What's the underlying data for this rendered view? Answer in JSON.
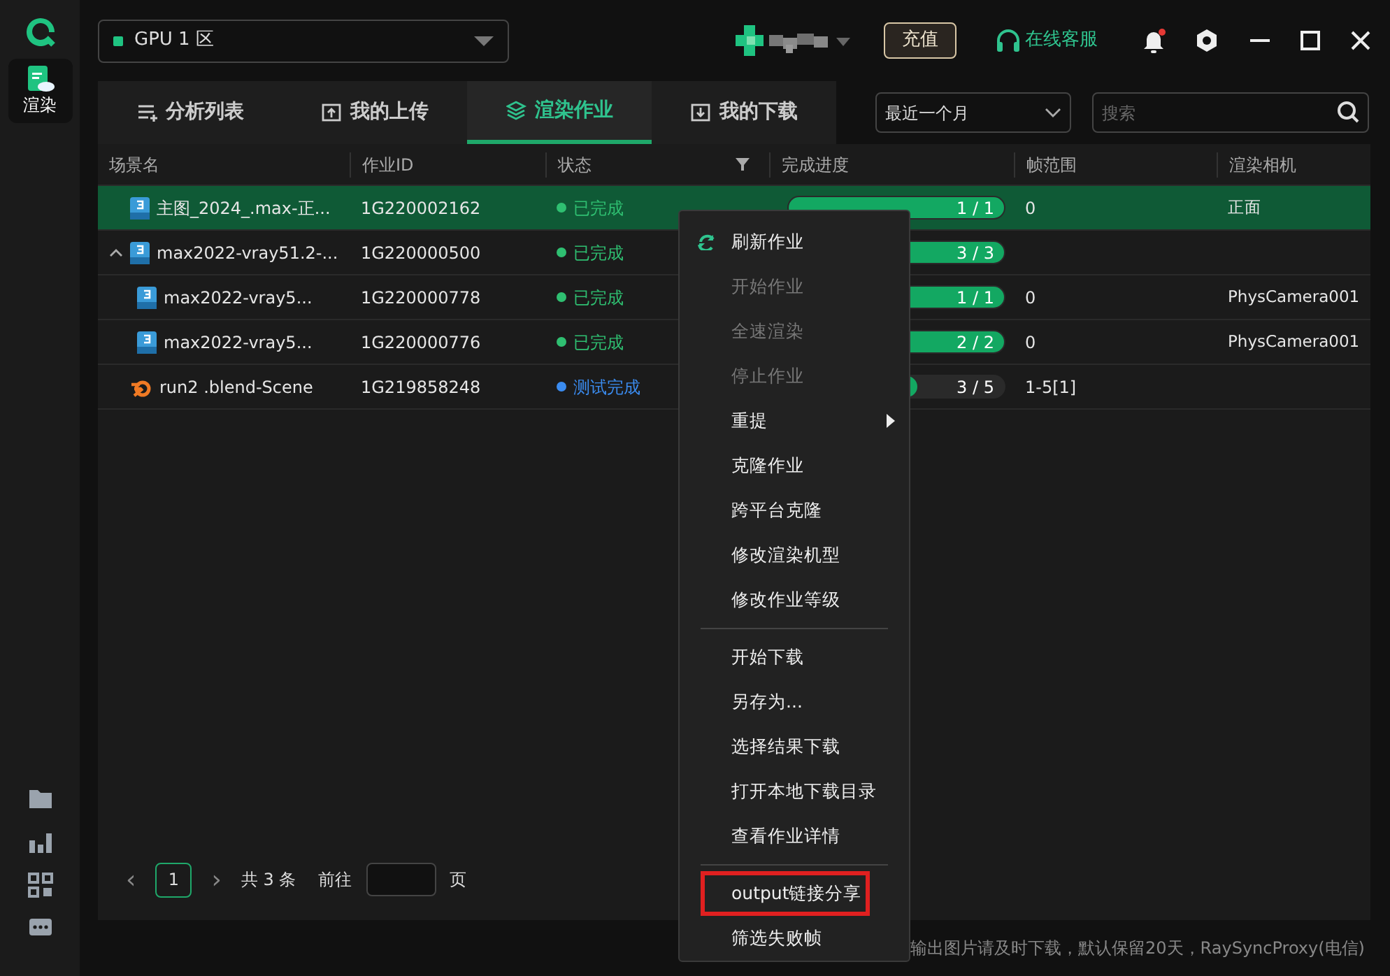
{
  "sidebar": {
    "items": [
      {
        "label": "渲染",
        "selected": true
      }
    ]
  },
  "region": {
    "label": "GPU 1 区"
  },
  "header": {
    "recharge": "充值",
    "support": "在线客服",
    "notification": true
  },
  "tabs": [
    {
      "label": "分析列表",
      "selected": false
    },
    {
      "label": "我的上传",
      "selected": false
    },
    {
      "label": "渲染作业",
      "selected": true
    },
    {
      "label": "我的下载",
      "selected": false
    }
  ],
  "period": {
    "value": "最近一个月"
  },
  "search": {
    "placeholder": "搜索"
  },
  "table": {
    "columns": [
      "场景名",
      "作业ID",
      "状态",
      "完成进度",
      "帧范围",
      "渲染相机"
    ],
    "rows": [
      {
        "kind": "max",
        "name": "主图_2024_.max-正...",
        "id": "1G220002162",
        "status": "已完成",
        "color": "#2fbf71",
        "level": 1,
        "count": "1 / 1",
        "frames": "0",
        "camera": "正面",
        "selected": true
      },
      {
        "kind": "max",
        "name": "max2022-vray51.2-...",
        "id": "1G220000500",
        "status": "已完成",
        "color": "#2fbf71",
        "level": 1,
        "count": "3 / 3",
        "selected": false,
        "expanded": true,
        "children": [
          {
            "kind": "max",
            "name": "max2022-vray5...",
            "id": "1G220000778",
            "status": "已完成",
            "color": "#2fbf71",
            "level": 1,
            "count": "1 / 1",
            "frames": "0",
            "camera": "PhysCamera001",
            "selected": false
          },
          {
            "kind": "max",
            "name": "max2022-vray5...",
            "id": "1G220000776",
            "status": "已完成",
            "color": "#2fbf71",
            "level": 1,
            "count": "2 / 2",
            "frames": "0",
            "camera": "PhysCamera001",
            "selected": false
          }
        ]
      },
      {
        "kind": "blend",
        "name": "run2 .blend-Scene",
        "id": "1G219858248",
        "status": "测试完成",
        "color": "#3b8cf0",
        "level": 0.6,
        "count": "3 / 5",
        "frames": "1-5[1]",
        "selected": false
      }
    ]
  },
  "pagination": {
    "prev": "‹",
    "page": "1",
    "next": "›",
    "total": "共 3 条",
    "goto": "前往",
    "unit": "页"
  },
  "status_bar": {
    "text": "输出图片请及时下载，默认保留20天，RaySyncProxy(电信)"
  },
  "context_menu": [
    {
      "kind": "refresh",
      "label": "刷新作业",
      "disabled": false,
      "highlighted": false
    },
    {
      "kind": "plain",
      "label": "开始作业",
      "disabled": true,
      "highlighted": false
    },
    {
      "kind": "plain",
      "label": "全速渲染",
      "disabled": true,
      "highlighted": false
    },
    {
      "kind": "plain",
      "label": "停止作业",
      "disabled": true,
      "highlighted": false
    },
    {
      "kind": "submenu",
      "label": "重提",
      "disabled": false,
      "highlighted": false
    },
    {
      "kind": "plain",
      "label": "克隆作业",
      "disabled": false,
      "highlighted": false
    },
    {
      "kind": "plain",
      "label": "跨平台克隆",
      "disabled": false,
      "highlighted": false
    },
    {
      "kind": "plain",
      "label": "修改渲染机型",
      "disabled": false,
      "highlighted": false
    },
    {
      "kind": "plain",
      "label": "修改作业等级",
      "disabled": false,
      "highlighted": false
    },
    {
      "kind": "separator"
    },
    {
      "kind": "plain",
      "label": "开始下载",
      "disabled": false,
      "highlighted": false
    },
    {
      "kind": "plain",
      "label": "另存为...",
      "disabled": false,
      "highlighted": false
    },
    {
      "kind": "plain",
      "label": "选择结果下载",
      "disabled": false,
      "highlighted": false
    },
    {
      "kind": "plain",
      "label": "打开本地下载目录",
      "disabled": false,
      "highlighted": false
    },
    {
      "kind": "plain",
      "label": "查看作业详情",
      "disabled": false,
      "highlighted": false
    },
    {
      "kind": "separator"
    },
    {
      "kind": "plain",
      "label": "output链接分享",
      "disabled": false,
      "highlighted": true
    },
    {
      "kind": "plain",
      "label": "筛选失败帧",
      "disabled": false,
      "highlighted": false
    }
  ]
}
